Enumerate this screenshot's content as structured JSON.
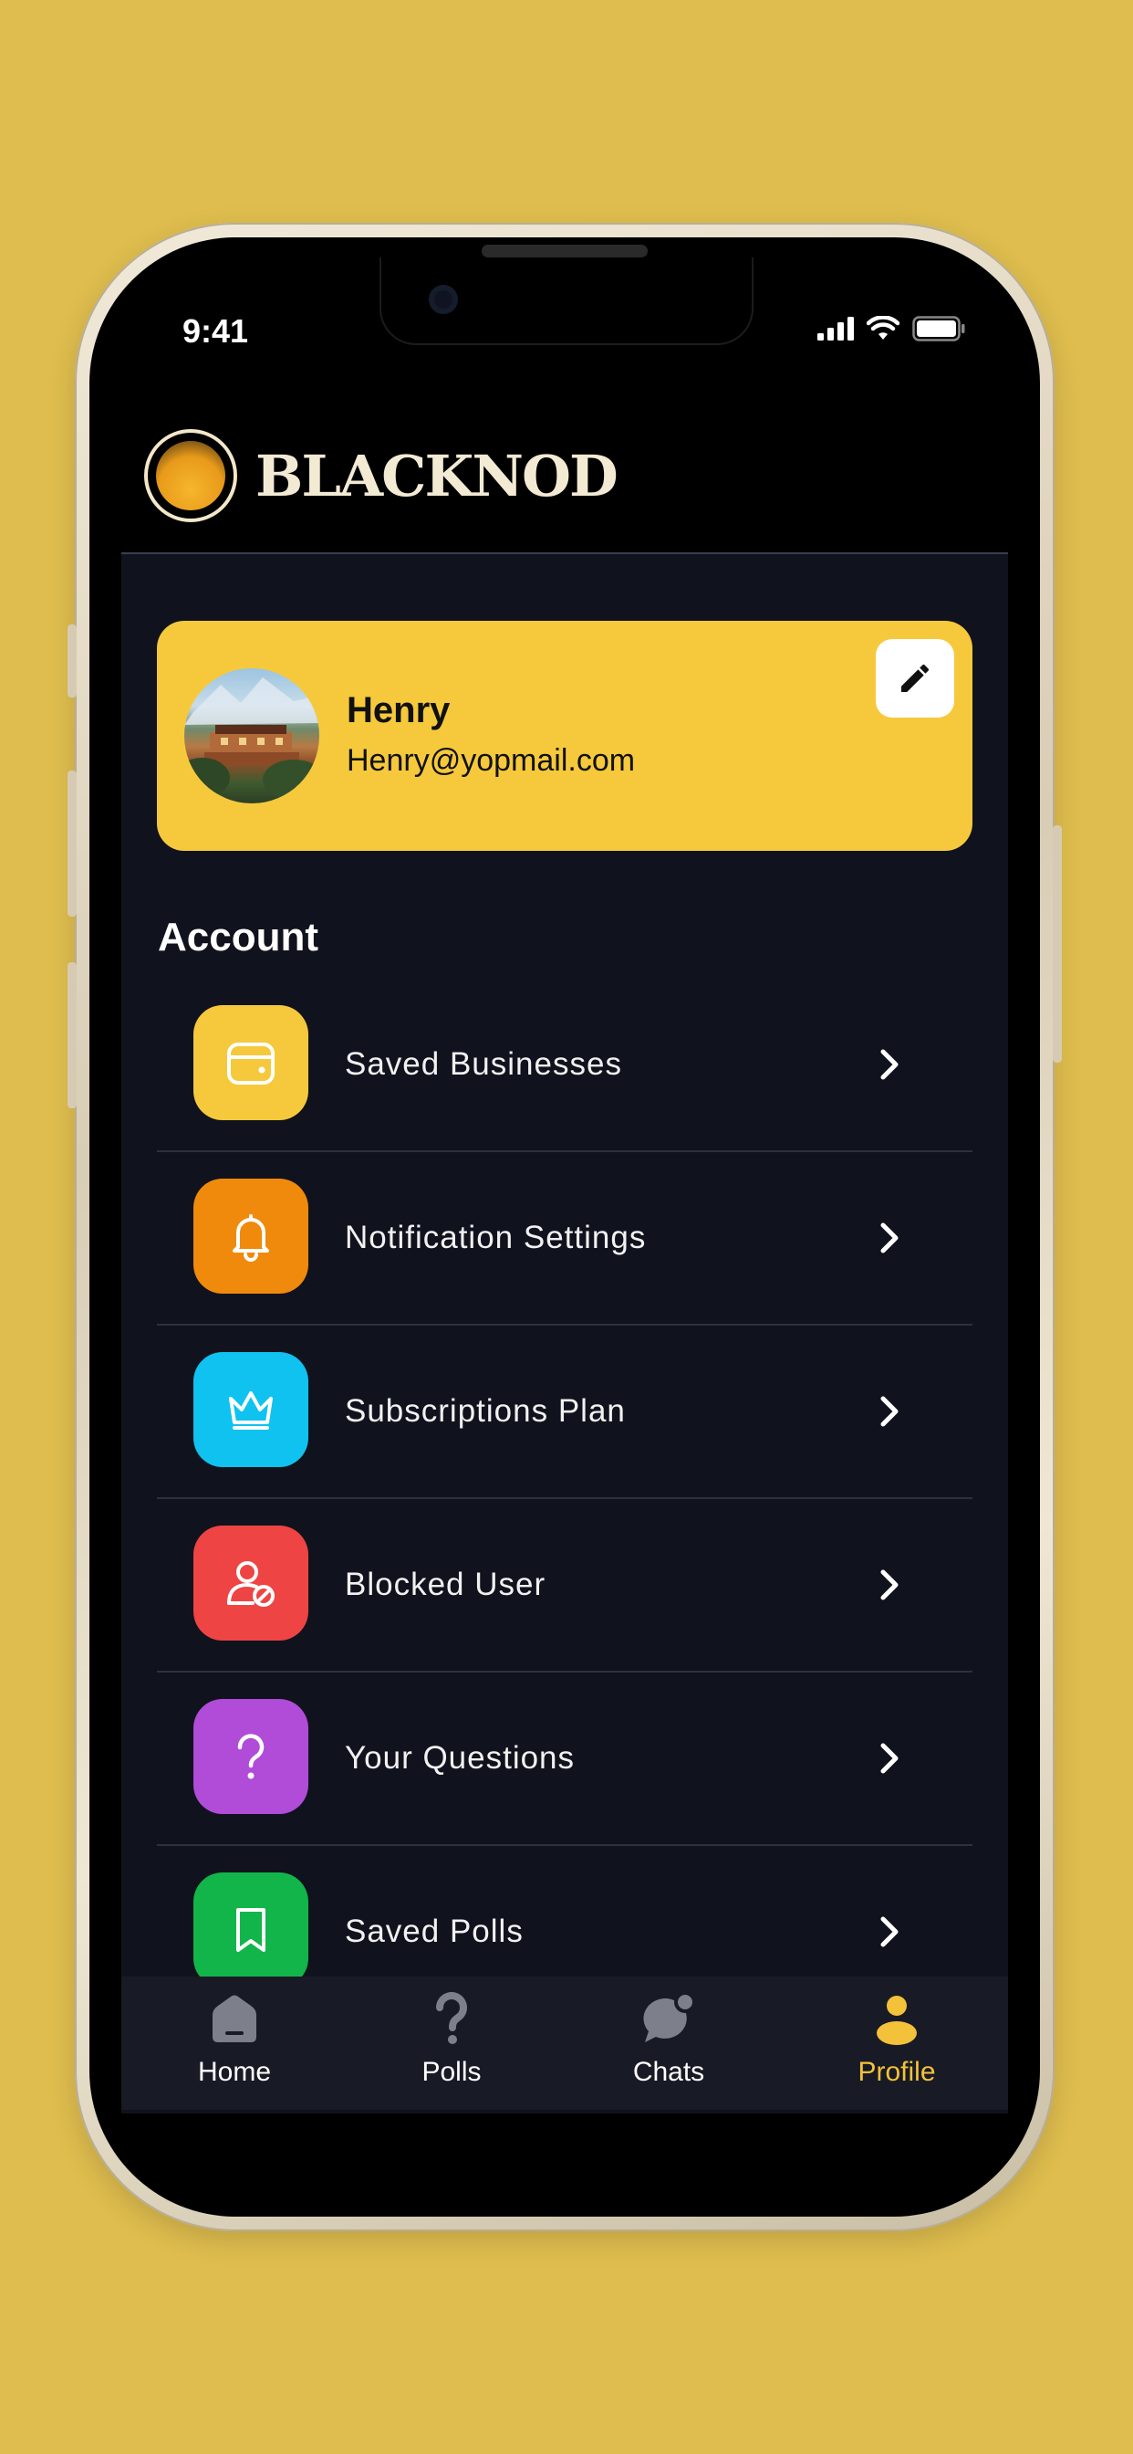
{
  "status_bar": {
    "time": "9:41"
  },
  "brand": {
    "name": "BLACKNOD"
  },
  "profile": {
    "name": "Henry",
    "email": "Henry@yopmail.com"
  },
  "account": {
    "title": "Account",
    "items": [
      {
        "label": "Saved Businesses",
        "icon": "wallet-icon",
        "color": "#f6c93c"
      },
      {
        "label": "Notification Settings",
        "icon": "bell-icon",
        "color": "#f08a0c"
      },
      {
        "label": "Subscriptions Plan",
        "icon": "crown-icon",
        "color": "#10c2f0"
      },
      {
        "label": "Blocked User",
        "icon": "blocked-user-icon",
        "color": "#ee4444"
      },
      {
        "label": "Your Questions",
        "icon": "question-icon",
        "color": "#b04cd8"
      },
      {
        "label": "Saved Polls",
        "icon": "bookmark-icon",
        "color": "#12b54a"
      }
    ]
  },
  "tabbar": {
    "tabs": [
      {
        "label": "Home",
        "icon": "home-icon",
        "active": false
      },
      {
        "label": "Polls",
        "icon": "question-mark-icon",
        "active": false
      },
      {
        "label": "Chats",
        "icon": "chat-bubble-icon",
        "active": false
      },
      {
        "label": "Profile",
        "icon": "person-icon",
        "active": true
      }
    ]
  },
  "colors": {
    "background": "#dfbd4e",
    "accent": "#f3c23a",
    "card": "#f6c93c",
    "surface": "#10131d"
  }
}
